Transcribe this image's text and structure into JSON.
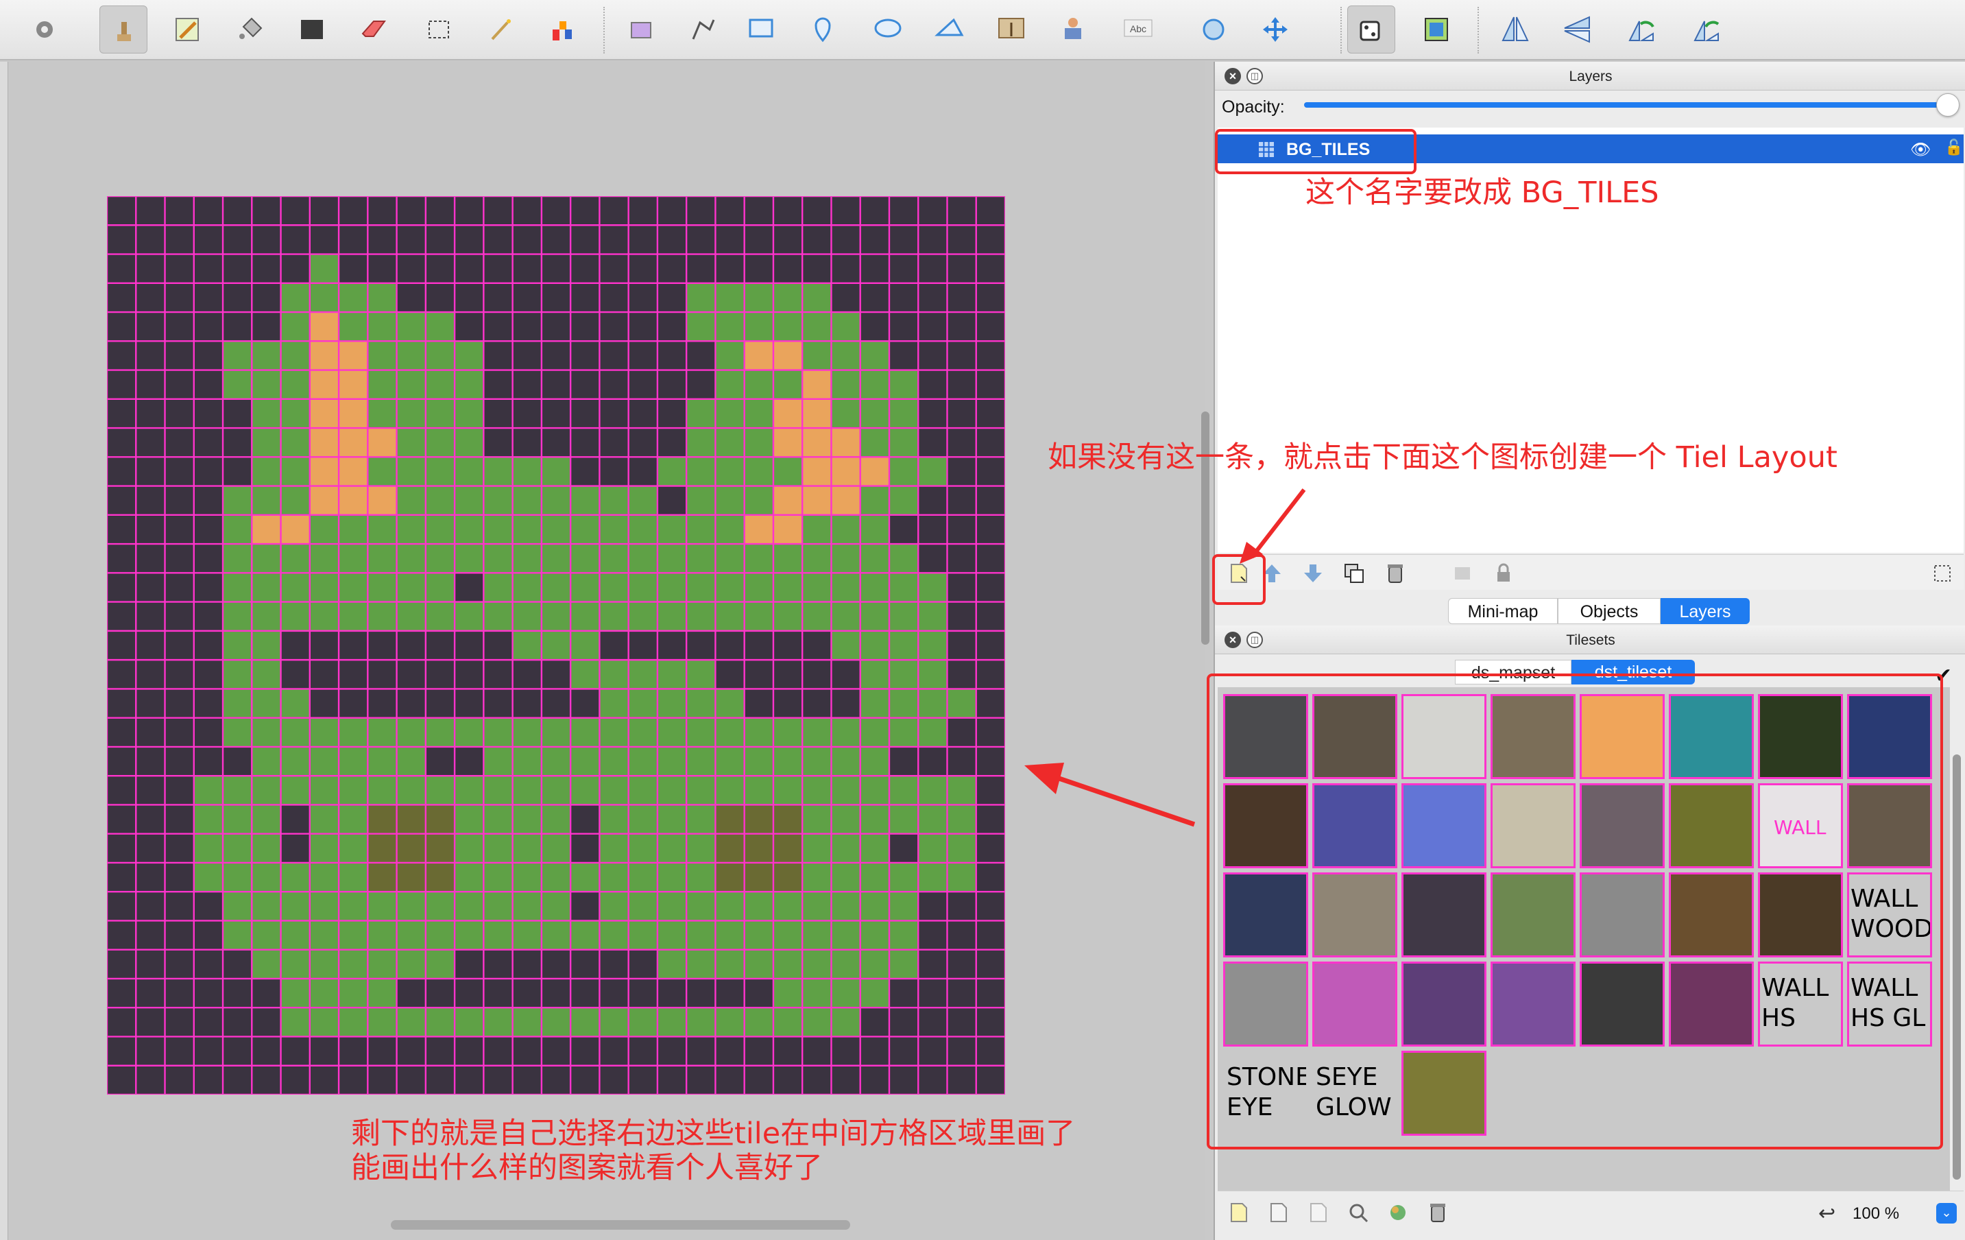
{
  "toolbar": {
    "tools": [
      "settings-icon",
      "stamp-icon",
      "pencil-icon",
      "fill-icon",
      "rectangle-fill-icon",
      "eraser-icon",
      "selection-icon",
      "magic-wand-icon",
      "color-picker-icon",
      "terrain-icon",
      "polyline-icon",
      "rectangle-icon",
      "point-icon",
      "ellipse-icon",
      "polygon-icon",
      "image-icon",
      "tile-object-icon",
      "text-icon",
      "rotate-icon",
      "move-icon",
      "random-icon",
      "tilemap-icon",
      "flip-horizontal-icon",
      "flip-vertical-icon",
      "rotate-left-icon",
      "rotate-right-icon"
    ]
  },
  "map": {
    "grid_color": "#ff33cc",
    "legend": {
      "W": "#3a3340",
      "G": "#5fa146",
      "O": "#eaa45c",
      "B": "#6a6a33"
    },
    "rows": [
      "WWWWWWWWWWWWWWWWWWWWWWWWWWWWWWW",
      "WWWWWWWWWWWWWWWWWWWWWWWWWWWWWWW",
      "WWWWWWWGWWWWWWWWWWWWWWWWWWWWWWW",
      "WWWWWWGGGGWWWWWWWWWWGGGGGWWWWWW",
      "WWWWWWGOGGGGWWWWWWWWGGGGGGWWWWW",
      "WWWWGGGOOGGGGWWWWWWWWGOOGGGWWWWW",
      "WWWWGGGOOGGGGWWWWWWWWGGGOGGGWWWW",
      "WWWWWGGOOGGGGWWWWWWWGGGOOGGGWWWW",
      "WWWWWGGOOOGGGWWWWWWWGGGOOOGGWWWW",
      "WWWWWGGOOGGGGGGGWWWGGGGGOOOGGWWWW",
      "WWWWGGGOOOGGGGGGGGGWGGGOOOGGWWWW",
      "WWWWGOOGGGGGGGGGGGGGGGOOGGGWWWWW",
      "WWWWGGGGGGGGGGGGGGGGGGGGGGGGWWWW",
      "WWWWGGGGGGGGWGGGGGGGGGGGGGGGGWWW",
      "WWWWGGGGGGGGGGGGGGGGGGGGGGGGGWWW",
      "WWWWGGWWWWWWWWGGGWWWWWWWWGGGGWWW",
      "WWWWGGWWWWWWWWWWGGGGGWWWWWGGGWWW",
      "WWWWGGGWWWWWWWWWWGGGGGWWWWGGGGWWW",
      "WWWWGGGGGGGGGGGGGGGGGGGGGGGGGWWW",
      "WWWWWGGGGGGWWGGGGGGGGGGGGGGWWWWW",
      "WWWGGGGGGGGGGGGGGGGGGGGGGGGGGGWW",
      "WWWGGGWGGBBBGGGGWGGGGBBBGGGGGGWW",
      "WWWGGGWGGBBBGGGGWGGGGBBBGGGWGGWW",
      "WWWGGGGGGBBBGGGGGGGGGBBBGGGGGGWW",
      "WWWWGGGGGGGGGGGGWGGGGGGGGGGGWWWW",
      "WWWWGGGGGGGGGGGGGGGGGGGGGGGGWWWW",
      "WWWWWGGGGGGGWWWWWWWGGGGGGGGGWWWWW",
      "WWWWWWGGGGWWWWWWWWWWWWWGGGGWWWWW",
      "WWWWWWGGGGGGGGGGGGGGGGGGGGWWWWWW",
      "WWWWWWWWWWWWWWWWWWWWWWWWWWWWWWW",
      "WWWWWWWWWWWWWWWWWWWWWWWWWWWWWWW"
    ]
  },
  "layers_panel": {
    "title": "Layers",
    "opacity_label": "Opacity:",
    "opacity_value": 1.0,
    "layers": [
      {
        "name": "BG_TILES",
        "visible": true,
        "selected": true
      }
    ]
  },
  "bottom_tabs": {
    "minimap": "Mini-map",
    "objects": "Objects",
    "layers": "Layers"
  },
  "tilesets_panel": {
    "title": "Tilesets",
    "tabs": [
      "ds_mapset",
      "dst_tileset"
    ],
    "tiles": [
      {
        "color": "#4b4b4e"
      },
      {
        "color": "#5d5346"
      },
      {
        "color": "#d4d4d0"
      },
      {
        "color": "#7b6e58"
      },
      {
        "color": "#f0a55a"
      },
      {
        "color": "#2c8f98"
      },
      {
        "color": "#2c3a1f"
      },
      {
        "color": "#293a73"
      },
      {
        "color": "#4a3728"
      },
      {
        "color": "#4d4fa0"
      },
      {
        "color": "#6275d6"
      },
      {
        "color": "#c7c0aa"
      },
      {
        "color": "#6d6068"
      },
      {
        "color": "#6f722c"
      },
      {
        "color": "#e7e3e6",
        "text": "WALL",
        "text_color": "#ff33cc"
      },
      {
        "color": "#66594a"
      },
      {
        "color": "#2f3a5c"
      },
      {
        "color": "#8f8575"
      },
      {
        "color": "#403846"
      },
      {
        "color": "#6d8850"
      },
      {
        "color": "#8a8a8a"
      },
      {
        "color": "#6a4f2e"
      },
      {
        "color": "#4b3a26"
      },
      {
        "color": "#c9c9c9",
        "text": "WALL\nWOOD"
      },
      {
        "color": "#8f8f8f"
      },
      {
        "color": "#c05ab8"
      },
      {
        "color": "#5d3e78"
      },
      {
        "color": "#7a4e9c"
      },
      {
        "color": "#3a3a3a"
      },
      {
        "color": "#6f3560"
      },
      {
        "color": "#c9c9c9",
        "text": "WALL\nHS"
      },
      {
        "color": "#c9c9c9",
        "text": "WALL\nHS GL"
      },
      {
        "color": "#c9c9c9",
        "text": "STONE\nEYE",
        "bare": true
      },
      {
        "color": "#c9c9c9",
        "text": "SEYE\nGLOW",
        "bare": true
      },
      {
        "color": "#7d7a36"
      }
    ],
    "zoom": "100 %"
  },
  "annotations": {
    "rename_note": "这个名字要改成 BG_TILES",
    "create_note": "如果没有这一条，就点击下面这个图标创建一个 Tiel Layout",
    "draw_note_line1": "剩下的就是自己选择右边这些tile在中间方格区域里画了",
    "draw_note_line2": "能画出什么样的图案就看个人喜好了",
    "color": "#ee2a2a"
  }
}
